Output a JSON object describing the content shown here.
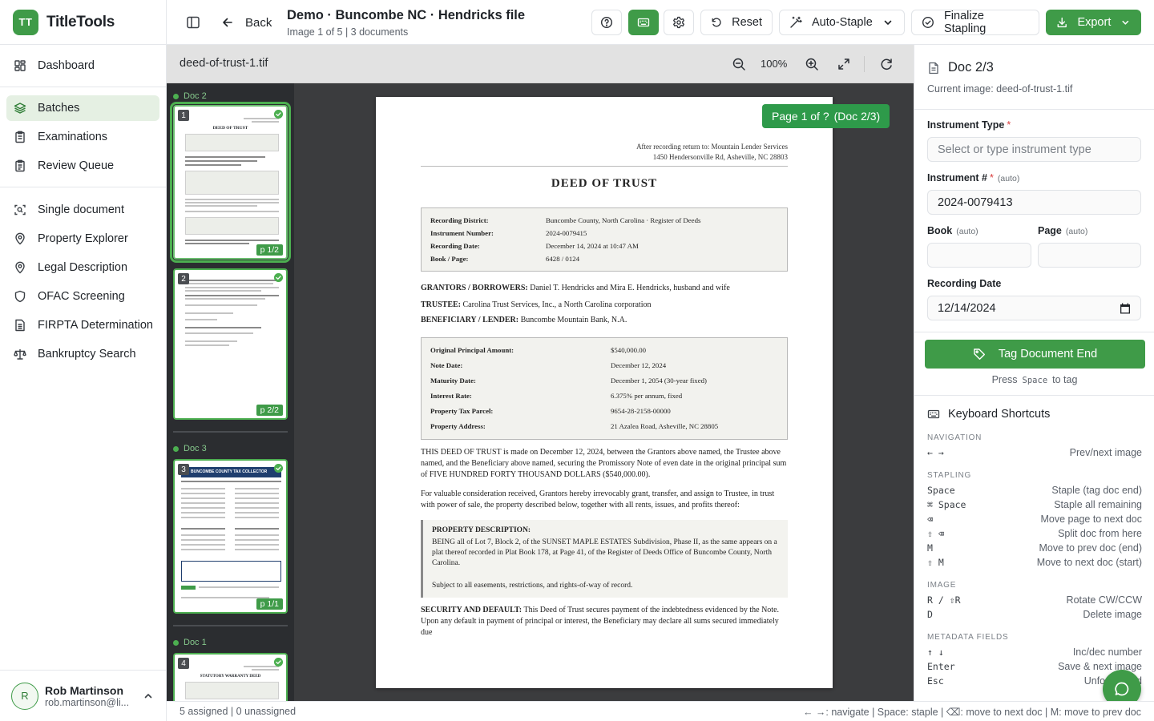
{
  "app": {
    "logo": "TT",
    "name": "TitleTools"
  },
  "nav": {
    "group1": [
      {
        "label": "Dashboard",
        "icon": "dashboard-icon"
      }
    ],
    "group2": [
      {
        "label": "Batches",
        "icon": "layers-icon",
        "active": true
      },
      {
        "label": "Examinations",
        "icon": "clipboard-icon"
      },
      {
        "label": "Review Queue",
        "icon": "clipboard-list-icon"
      }
    ],
    "group3": [
      {
        "label": "Single document",
        "icon": "scan-document-icon"
      },
      {
        "label": "Property Explorer",
        "icon": "map-pin-icon"
      },
      {
        "label": "Legal Description",
        "icon": "map-pin-icon"
      },
      {
        "label": "OFAC Screening",
        "icon": "shield-icon"
      },
      {
        "label": "FIRPTA Determination",
        "icon": "file-text-icon"
      },
      {
        "label": "Bankruptcy Search",
        "icon": "scale-icon"
      }
    ]
  },
  "user": {
    "initial": "R",
    "name": "Rob Martinson",
    "email": "rob.martinson@li..."
  },
  "header": {
    "back_label": "Back",
    "title": "Demo · Buncombe NC · Hendricks file",
    "subtitle": "Image 1 of 5 | 3 documents",
    "reset_label": "Reset",
    "autostaple_label": "Auto-Staple",
    "finalize_label": "Finalize Stapling",
    "export_label": "Export"
  },
  "viewer": {
    "filename": "deed-of-trust-1.tif",
    "zoom": "100%"
  },
  "thumbnails": [
    {
      "group": "Doc 2",
      "num": "1",
      "page": "p 1/2",
      "selected": true
    },
    {
      "group": "Doc 2",
      "num": "2",
      "page": "p 2/2",
      "selected": false
    },
    {
      "group": "Doc 3",
      "num": "3",
      "page": "p 1/1",
      "selected": false
    },
    {
      "group": "Doc 1",
      "num": "4",
      "page": "",
      "selected": false
    }
  ],
  "thumb_groups": {
    "doc2": "Doc 2",
    "doc3": "Doc 3",
    "doc1": "Doc 1"
  },
  "thumb_text": {
    "t1_title": "DEED OF TRUST",
    "t3_title": "BUNCOMBE COUNTY TAX COLLECTOR",
    "t4_title": "STATUTORY WARRANTY DEED"
  },
  "badge": {
    "page": "Page 1 of ?",
    "doc": "(Doc 2/3)"
  },
  "document": {
    "return_line1": "After recording return to: Mountain Lender Services",
    "return_line2": "1450 Hendersonville Rd, Asheville, NC 28803",
    "title": "DEED OF TRUST",
    "recording": [
      {
        "k": "Recording District:",
        "v": "Buncombe County, North Carolina · Register of Deeds"
      },
      {
        "k": "Instrument Number:",
        "v": "2024-0079415"
      },
      {
        "k": "Recording Date:",
        "v": "December 14, 2024 at 10:47 AM"
      },
      {
        "k": "Book / Page:",
        "v": "6428 / 0124"
      }
    ],
    "grantors_k": "GRANTORS / BORROWERS:",
    "grantors_v": "Daniel T. Hendricks and Mira E. Hendricks, husband and wife",
    "trustee_k": "TRUSTEE:",
    "trustee_v": "Carolina Trust Services, Inc., a North Carolina corporation",
    "beneficiary_k": "BENEFICIARY / LENDER:",
    "beneficiary_v": "Buncombe Mountain Bank, N.A.",
    "loan": [
      {
        "k": "Original Principal Amount:",
        "v": "$540,000.00"
      },
      {
        "k": "Note Date:",
        "v": "December 12, 2024"
      },
      {
        "k": "Maturity Date:",
        "v": "December 1, 2054 (30-year fixed)"
      },
      {
        "k": "Interest Rate:",
        "v": "6.375% per annum, fixed"
      },
      {
        "k": "Property Tax Parcel:",
        "v": "9654-28-2158-00000"
      },
      {
        "k": "Property Address:",
        "v": "21 Azalea Road, Asheville, NC 28805"
      }
    ],
    "para1": "THIS DEED OF TRUST is made on December 12, 2024, between the Grantors above named, the Trustee above named, and the Beneficiary above named, securing the Promissory Note of even date in the original principal sum of FIVE HUNDRED FORTY THOUSAND DOLLARS ($540,000.00).",
    "para2": "For valuable consideration received, Grantors hereby irrevocably grant, transfer, and assign to Trustee, in trust with power of sale, the property described below, together with all rents, issues, and profits thereof:",
    "prop_title": "PROPERTY DESCRIPTION:",
    "prop_text": "BEING all of Lot 7, Block 2, of the SUNSET MAPLE ESTATES Subdivision, Phase II, as the same appears on a plat thereof recorded in Plat Book 178, at Page 41, of the Register of Deeds Office of Buncombe County, North Carolina.",
    "prop_text2": "Subject to all easements, restrictions, and rights-of-way of record.",
    "sec_k": "SECURITY AND DEFAULT:",
    "sec_v": "This Deed of Trust secures payment of the indebtedness evidenced by the Note. Upon any default in payment of principal or interest, the Beneficiary may declare all sums secured immediately due"
  },
  "panel": {
    "title": "Doc 2/3",
    "current_image": "Current image: deed-of-trust-1.tif",
    "instrument_type_label": "Instrument Type",
    "instrument_type_placeholder": "Select or type instrument type",
    "instrument_num_label": "Instrument #",
    "instrument_num_value": "2024-0079413",
    "auto": "(auto)",
    "book_label": "Book",
    "page_label": "Page",
    "recording_date_label": "Recording Date",
    "recording_date_value": "12/14/2024",
    "required_mark": "*",
    "tag_button": "Tag Document End",
    "press_pre": "Press",
    "press_key": "Space",
    "press_post": "to tag",
    "shortcuts_title": "Keyboard Shortcuts",
    "shortcut_sections": {
      "navigation": "NAVIGATION",
      "stapling": "STAPLING",
      "image": "IMAGE",
      "metadata": "METADATA FIELDS"
    },
    "shortcuts": {
      "navigation": [
        {
          "k": "← →",
          "d": "Prev/next image"
        }
      ],
      "stapling": [
        {
          "k": "Space",
          "d": "Staple (tag doc end)"
        },
        {
          "k": "⌘ Space",
          "d": "Staple all remaining"
        },
        {
          "k": "⌫",
          "d": "Move page to next doc"
        },
        {
          "k": "⇧ ⌫",
          "d": "Split doc from here"
        },
        {
          "k": "M",
          "d": "Move to prev doc (end)"
        },
        {
          "k": "⇧ M",
          "d": "Move to next doc (start)"
        }
      ],
      "image": [
        {
          "k": "R / ⇧R",
          "d": "Rotate CW/CCW"
        },
        {
          "k": "D",
          "d": "Delete image"
        }
      ],
      "metadata": [
        {
          "k": "↑ ↓",
          "d": "Inc/dec number"
        },
        {
          "k": "Enter",
          "d": "Save & next image"
        },
        {
          "k": "Esc",
          "d": "Unfocus field"
        }
      ]
    }
  },
  "status": {
    "left": "5 assigned | 0 unassigned",
    "right": "← →: navigate | Space: staple | ⌫: move to next doc | M: move to prev doc"
  },
  "colors": {
    "accent": "#3f9b48",
    "accent_light": "#e5f0e3",
    "viewer_bg": "#3b3c3e",
    "thumbs_bg": "#2b2d30"
  }
}
